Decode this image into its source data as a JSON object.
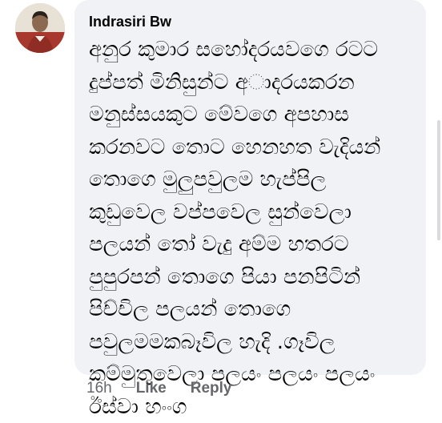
{
  "comment": {
    "author": "Indrasiri Bw",
    "lines": [
      "අනුර කුමාර සහෝදරයවගෙ රටට",
      "දුප්පත් මිනිසුන්ට අ◌ාදරයකරන",
      "මනුස්සයකුට මේවගෙ අපහාස",
      "කරනවට  තොට හෙනහත වැදියන්",
      "තොගෙ මුලුපවුලම හැප්පිල",
      "කුඩුවෙල වප්පවෙල සුන්වෙලා",
      "පලයන්  තෝ වැදු අම්ම හතරට",
      "පුපුරපන් තොගෙ පියා  පනපිටින්",
      "පිච්චිල පලයන් තොගෙ",
      "පවුලමමකබෑවිල හැදි .ගෑවිල",
      "කම්මුතුවෙලා පලයං පලයං පලයං",
      "ඊස්වා හංංග"
    ],
    "time": "16h",
    "like_label": "Like",
    "reply_label": "Reply"
  },
  "colors": {
    "bubble_bg": "#f0f2f5",
    "meta_text": "#65676b",
    "body_text": "#050505"
  }
}
